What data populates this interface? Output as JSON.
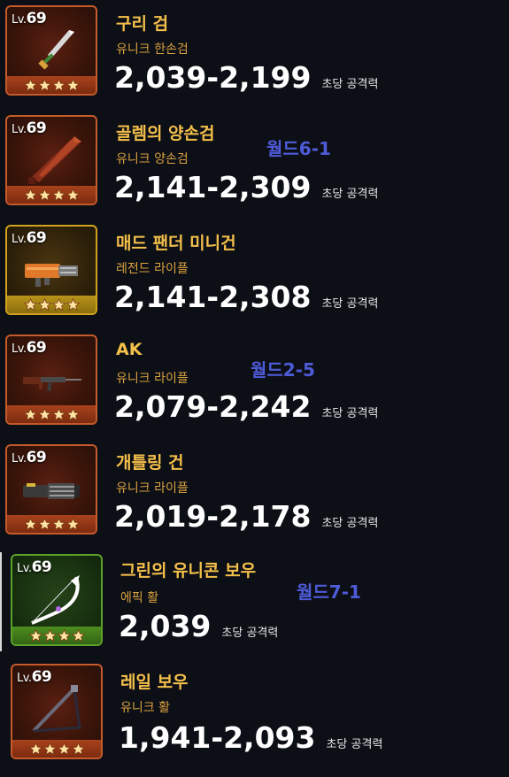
{
  "unit_label": "초당 공격력",
  "lv_prefix": "Lv.",
  "weapons": [
    {
      "level": "69",
      "name": "구리 검",
      "type": "유니크 한손검",
      "damage": "2,039-2,199",
      "rarity": "unique",
      "stars": 4,
      "icon": "copper-sword-icon",
      "note": ""
    },
    {
      "level": "69",
      "name": "골렘의 양손검",
      "type": "유니크 양손검",
      "damage": "2,141-2,309",
      "rarity": "unique",
      "stars": 4,
      "icon": "golem-greatsword-icon",
      "note": "월드6-1"
    },
    {
      "level": "69",
      "name": "매드 팬더 미니건",
      "type": "레전드 라이플",
      "damage": "2,141-2,308",
      "rarity": "legend",
      "stars": 4,
      "icon": "minigun-icon",
      "note": ""
    },
    {
      "level": "69",
      "name": "AK",
      "type": "유니크 라이플",
      "damage": "2,079-2,242",
      "rarity": "unique",
      "stars": 4,
      "icon": "rifle-icon",
      "note": "월드2-5"
    },
    {
      "level": "69",
      "name": "개틀링 건",
      "type": "유니크 라이플",
      "damage": "2,019-2,178",
      "rarity": "unique",
      "stars": 4,
      "icon": "gatling-gun-icon",
      "note": ""
    },
    {
      "level": "69",
      "name": "그린의 유니콘 보우",
      "type": "에픽 활",
      "damage": "2,039",
      "rarity": "epic",
      "stars": 4,
      "icon": "unicorn-bow-icon",
      "note": "월드7-1"
    },
    {
      "level": "69",
      "name": "레일 보우",
      "type": "유니크 활",
      "damage": "1,941-2,093",
      "rarity": "unique",
      "stars": 4,
      "icon": "rail-bow-icon",
      "note": ""
    }
  ],
  "colors": {
    "background": "#0d0f17",
    "unique_border": "#c55a2a",
    "legend_border": "#d1a21c",
    "epic_border": "#5aa22c",
    "name_text": "#f4c04a",
    "note_text": "#4e5bd8"
  }
}
